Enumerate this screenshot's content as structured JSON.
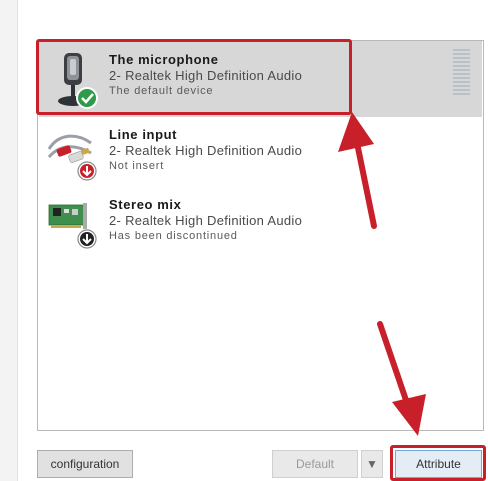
{
  "devices": [
    {
      "name": "The microphone",
      "driver": "2- Realtek High Definition Audio",
      "status": "The default device",
      "icon": "microphone-icon",
      "badge": "check",
      "selected": true
    },
    {
      "name": "Line input",
      "driver": "2- Realtek High Definition Audio",
      "status": "Not insert",
      "icon": "line-input-cable-icon",
      "badge": "down-red",
      "selected": false
    },
    {
      "name": "Stereo mix",
      "driver": "2- Realtek High Definition Audio",
      "status": "Has been discontinued",
      "icon": "sound-card-icon",
      "badge": "down-black",
      "selected": false
    }
  ],
  "buttons": {
    "configuration": "configuration",
    "default": "Default",
    "dropdown_glyph": "▼",
    "attribute": "Attribute"
  },
  "colors": {
    "highlight": "#c8202a",
    "selected_row": "#d7d7d7",
    "check_badge": "#2e9a4a"
  }
}
